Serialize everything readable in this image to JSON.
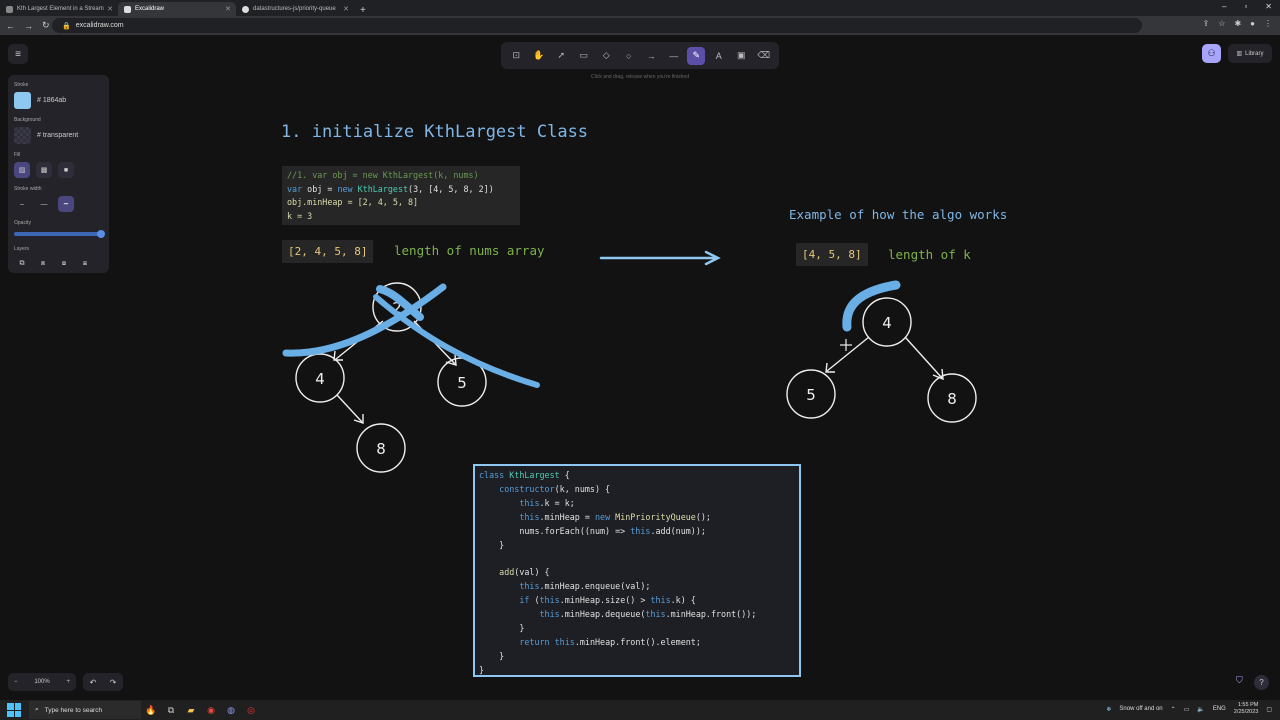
{
  "browser": {
    "tabs": [
      {
        "title": "Kth Largest Element in a Stream",
        "active": false
      },
      {
        "title": "Excalidraw",
        "active": true
      },
      {
        "title": "datastructures-js/priority-queue",
        "active": false
      }
    ],
    "url": "excalidraw.com"
  },
  "toolbar": {
    "tools": [
      "lock-icon",
      "hand-icon",
      "pointer-icon",
      "rectangle-icon",
      "diamond-icon",
      "ellipse-icon",
      "arrow-icon",
      "line-icon",
      "pencil-icon",
      "text-icon",
      "image-icon",
      "eraser-icon"
    ],
    "active_tool": "pencil-icon",
    "hint": "Click and drag, release when you're finished"
  },
  "library_label": "Library",
  "properties": {
    "stroke_label": "Stroke",
    "stroke_hex": "1864ab",
    "stroke_color": "#8ec8f0",
    "background_label": "Background",
    "background_hex": "transparent",
    "fill_label": "Fill",
    "stroke_width_label": "Stroke width",
    "opacity_label": "Opacity",
    "opacity": 1,
    "layers_label": "Layers"
  },
  "zoom": {
    "level": "100%",
    "minus": "−",
    "plus": "+"
  },
  "canvas": {
    "title": "1. initialize KthLargest Class",
    "code1": {
      "line1": "//1. var obj = new KthLargest(k, nums)",
      "line2_a": "var",
      "line2_b": " obj = ",
      "line2_c": "new",
      "line2_d": " KthLargest",
      "line2_e": "(3, [4, 5, 8, 2])",
      "line3": "obj.minHeap = [2, 4, 5, 8]",
      "line4": "k = 3"
    },
    "array1": "[2, 4, 5, 8]",
    "array1_label": "length of nums array",
    "example_title": "Example of how the algo works",
    "array2": "[4, 5, 8]",
    "array2_label": "length of k",
    "tree1": {
      "root": "2",
      "left": "4",
      "right": "5",
      "left_child": "8"
    },
    "tree2": {
      "root": "4",
      "left": "5",
      "right": "8"
    }
  },
  "code2": {
    "l1_kw": "class",
    "l1_name": " KthLargest",
    "l1_rest": " {",
    "l2_fn": "    constructor",
    "l2_rest": "(k, nums) {",
    "l3_this": "        this",
    "l3_rest": ".k = k;",
    "l4_this": "        this",
    "l4_mid": ".minHeap = ",
    "l4_new": "new",
    "l4_cls": " MinPriorityQueue",
    "l4_end": "();",
    "l5": "        nums.forEach((num) => ",
    "l5_this": "this",
    "l5_end": ".add(num));",
    "l6": "    }",
    "l7": "",
    "l8_fn": "    add",
    "l8_rest": "(val) {",
    "l9_this": "        this",
    "l9_rest": ".minHeap.enqueue(val);",
    "l10_kw": "        if",
    "l10_a": " (",
    "l10_this": "this",
    "l10_b": ".minHeap.size() > ",
    "l10_this2": "this",
    "l10_c": ".k) {",
    "l11_this": "            this",
    "l11_a": ".minHeap.dequeue(",
    "l11_this2": "this",
    "l11_b": ".minHeap.front());",
    "l12": "        }",
    "l13_kw": "        return",
    "l13_this": " this",
    "l13_rest": ".minHeap.front().element;",
    "l14": "    }",
    "l15": "}"
  },
  "taskbar": {
    "search_placeholder": "Type here to search",
    "weather": "Snow off and on",
    "lang": "ENG",
    "time": "1:55 PM",
    "date": "2/25/2023"
  }
}
